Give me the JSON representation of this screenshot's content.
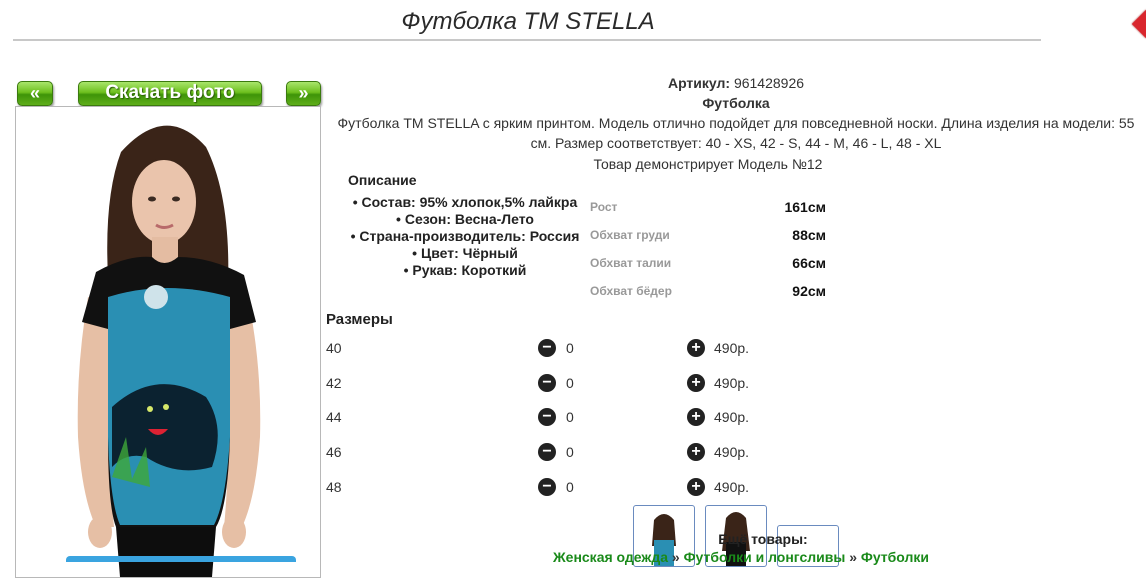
{
  "page": {
    "title": "Футболка ТМ STELLA"
  },
  "gallery": {
    "prev_label": "«",
    "download_label": "Скачать фото",
    "next_label": "»"
  },
  "info": {
    "sku_label": "Артикул:",
    "sku_value": "961428926",
    "type": "Футболка",
    "description_line1": "Футболка ТМ STELLA с ярким принтом. Модель отлично подойдет для повседневной носки. Длина изделия на модели: 55",
    "description_line2": "см. Размер соответствует: 40 - XS, 42 - S, 44 - M, 46 - L, 48 - XL",
    "model_line": "Товар демонстрирует Модель №12"
  },
  "features": {
    "heading": "Описание",
    "items": [
      "Состав: 95% хлопок,5% лайкра",
      "Сезон: Весна-Лето",
      "Страна-производитель: Россия",
      "Цвет: Чёрный",
      "Рукав: Короткий"
    ]
  },
  "measurements": [
    {
      "label": "Рост",
      "value": "161см"
    },
    {
      "label": "Обхват груди",
      "value": "88см"
    },
    {
      "label": "Обхват талии",
      "value": "66см"
    },
    {
      "label": "Обхват бёдер",
      "value": "92см"
    }
  ],
  "sizes": {
    "heading": "Размеры",
    "rows": [
      {
        "size": "40",
        "qty": "0",
        "price": "490р."
      },
      {
        "size": "42",
        "qty": "0",
        "price": "490р."
      },
      {
        "size": "44",
        "qty": "0",
        "price": "490р."
      },
      {
        "size": "46",
        "qty": "0",
        "price": "490р."
      },
      {
        "size": "48",
        "qty": "0",
        "price": "490р."
      }
    ]
  },
  "more": {
    "heading": "Ещё товары:",
    "crumbs": [
      "Женская одежда",
      "Футболки и лонгсливы",
      "Футболки"
    ],
    "separator": "»"
  },
  "colors": {
    "accent_green": "#5fae1a",
    "link_green": "#1a8a1a",
    "shirt_blue": "#2a8fb3"
  },
  "icons": [
    "minus-circle-icon",
    "plus-circle-icon",
    "logo-icon"
  ]
}
